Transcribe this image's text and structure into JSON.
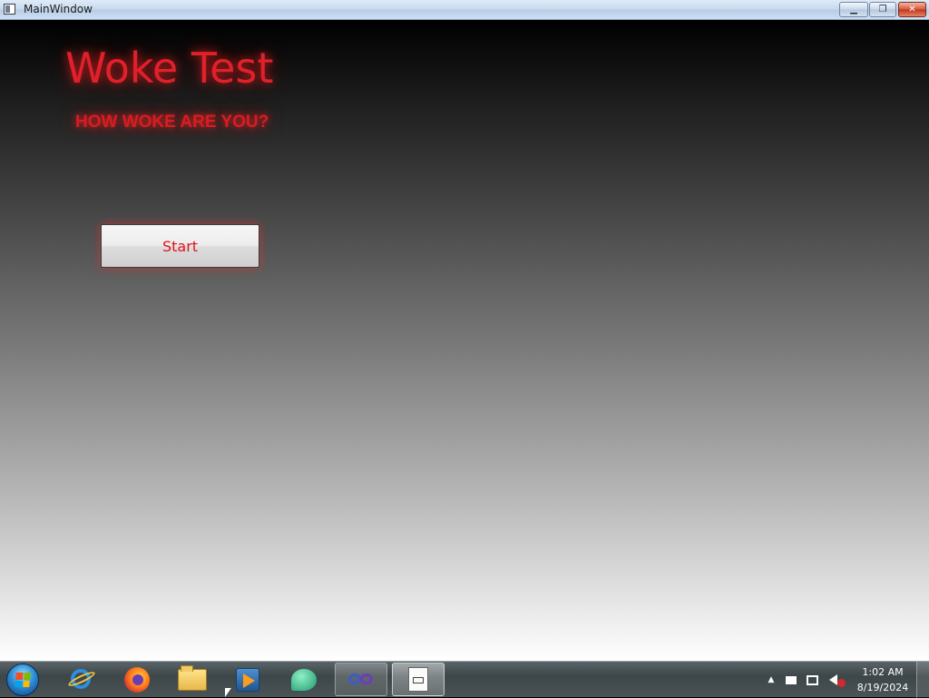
{
  "window": {
    "title": "MainWindow",
    "controls": {
      "minimize": "minimize",
      "maximize": "restore",
      "close": "close"
    }
  },
  "app": {
    "title": "Woke Test",
    "subtitle": "HOW WOKE ARE YOU?",
    "start_label": "Start",
    "accent_color": "#e0202a"
  },
  "taskbar": {
    "items": [
      {
        "name": "internet-explorer-icon",
        "state": "pinned"
      },
      {
        "name": "firefox-icon",
        "state": "pinned"
      },
      {
        "name": "file-explorer-icon",
        "state": "pinned"
      },
      {
        "name": "media-player-icon",
        "state": "pinned"
      },
      {
        "name": "chat-app-icon",
        "state": "pinned"
      },
      {
        "name": "infinity-app-icon",
        "state": "running"
      },
      {
        "name": "document-app-icon",
        "state": "active"
      }
    ],
    "tray_icons": [
      "show-hidden-icons-arrow",
      "action-center-flag-icon",
      "network-icon",
      "volume-muted-icon"
    ],
    "clock": {
      "time": "1:02 AM",
      "date": "8/19/2024"
    }
  }
}
